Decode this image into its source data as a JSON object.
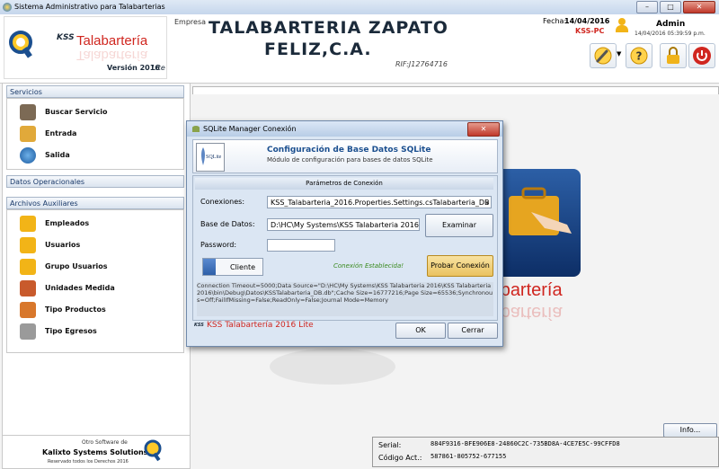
{
  "window": {
    "title": "Sistema Administrativo para Talabarterias",
    "min_glyph": "–",
    "max_glyph": "□",
    "close_glyph": "✕"
  },
  "header": {
    "app_brand_prefix": "KSS",
    "app_brand_name": "Talabartería",
    "version_label": "Versión 2016",
    "version_edition": "Lite",
    "empresa_label": "Empresa",
    "company_line1": "TALABARTERIA ZAPATO",
    "company_line2": "FELIZ,C.A.",
    "rif": "RIF:J12764716",
    "fecha_label": "Fecha:",
    "fecha_value": "14/04/2016",
    "pc_name": "KSS-PC",
    "user_name": "Admin",
    "user_datetime": "14/04/2016 05:39:59 p.m."
  },
  "sidebar": {
    "sections": [
      {
        "title": "Servicios",
        "items": [
          {
            "label": "Buscar Servicio",
            "icon": "search-service-icon"
          },
          {
            "label": "Entrada",
            "icon": "entry-icon"
          },
          {
            "label": "Salida",
            "icon": "exit-icon"
          }
        ]
      },
      {
        "title": "Datos Operacionales",
        "items": []
      },
      {
        "title": "Archivos Auxiliares",
        "items": [
          {
            "label": "Empleados",
            "icon": "employees-icon"
          },
          {
            "label": "Usuarios",
            "icon": "users-icon"
          },
          {
            "label": "Grupo Usuarios",
            "icon": "user-group-icon"
          },
          {
            "label": "Unidades Medida",
            "icon": "units-icon"
          },
          {
            "label": "Tipo Productos",
            "icon": "product-types-icon"
          },
          {
            "label": "Tipo Egresos",
            "icon": "expense-types-icon"
          }
        ]
      }
    ]
  },
  "footer": {
    "software_by": "Otro Software de",
    "company": "Kalixto Systems Solutions",
    "rights": "Reservado todos los Derechos 2016",
    "info_button": "Info...",
    "serial_label": "Serial:",
    "serial_value": "884F9316-BFE906E8-24860C2C-735BD8A-4CE7E5C-99CFFD8",
    "code_label": "Código Act.:",
    "code_value": "587861-805752-677155"
  },
  "dialog": {
    "title": "SQLite Manager Conexión",
    "logo_text": "SQLite",
    "heading": "Configuración de Base Datos SQLite",
    "subheading": "Módulo de configuración para bases de datos SQLite",
    "params_title": "Parámetros de Conexión",
    "conexiones_label": "Conexiones:",
    "conexiones_value": "KSS_Talabarteria_2016.Properties.Settings.csTalabarteria_DB",
    "base_label": "Base de Datos:",
    "base_value": "D:\\HC\\My Systems\\KSS Talabarteria 2016\\",
    "examinar_button": "Examinar",
    "password_label": "Password:",
    "password_value": "",
    "cliente_toggle": "Cliente",
    "status": "Conexión Establecida!",
    "probar_button": "Probar Conexión",
    "connection_string": "Connection Timeout=5000;Data Source=\"D:\\HC\\My Systems\\KSS Talabarteria 2016\\KSS Talabarteria 2016\\bin\\Debug\\Datos\\KSSTalabarteria_DB.db\";Cache Size=16777216;Page Size=65536;Synchronous=Off;FailIfMissing=False;ReadOnly=False;Journal Mode=Memory",
    "footer_brand": "KSS  Talabartería 2016 Lite",
    "ok_button": "OK",
    "cancel_button": "Cerrar",
    "close_glyph": "✕"
  },
  "background_brand": "Talabartería",
  "colors": {
    "brand_red": "#d0261f",
    "accent_blue": "#1b4f8f",
    "status_green": "#3a8a1e",
    "probar_bg": "#f0d27a"
  }
}
